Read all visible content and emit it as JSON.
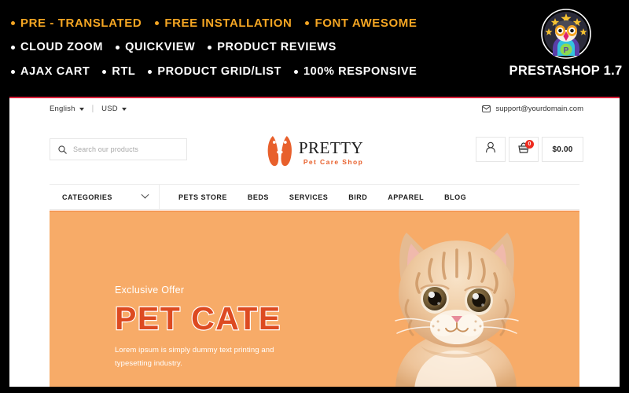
{
  "promo": {
    "rows": [
      {
        "style": "gold",
        "items": [
          {
            "label": "PRE - TRANSLATED",
            "bullet": "diamond-bullet-icon"
          },
          {
            "label": "FREE INSTALLATION",
            "bullet": "diamond-bullet-icon"
          },
          {
            "label": "FONT AWESOME",
            "bullet": "diamond-bullet-icon"
          }
        ]
      },
      {
        "style": "white",
        "items": [
          {
            "label": "CLOUD ZOOM",
            "bullet": "dot-bullet-icon"
          },
          {
            "label": "QUICKVIEW",
            "bullet": "dot-bullet-icon"
          },
          {
            "label": "PRODUCT REVIEWS",
            "bullet": "dot-bullet-icon"
          }
        ]
      },
      {
        "style": "white",
        "items": [
          {
            "label": "AJAX CART",
            "bullet": "dot-bullet-icon"
          },
          {
            "label": "RTL",
            "bullet": "dot-bullet-icon"
          },
          {
            "label": "PRODUCT GRID/LIST",
            "bullet": "dot-bullet-icon"
          },
          {
            "label": "100% RESPONSIVE",
            "bullet": "dot-bullet-icon"
          }
        ]
      }
    ],
    "prestashop": {
      "name": "PRESTASHOP 1.7",
      "logo_icon": "prestashop-owl-logo-icon"
    },
    "colors": {
      "background": "#000000",
      "gold": "#f5a623",
      "white": "#ffffff"
    }
  },
  "store": {
    "top_rule_color": "#d8203a",
    "utility": {
      "language": "English",
      "currency": "USD",
      "separator": "|",
      "support_email": "support@yourdomain.com",
      "mail_icon": "envelope-icon"
    },
    "search": {
      "placeholder": "Search our products",
      "value": "",
      "icon": "search-icon"
    },
    "brand": {
      "title": "PRETTY",
      "tagline": "Pet Care Shop",
      "mark_icon": "two-dogs-logo-icon",
      "accent": "#e8602c"
    },
    "actions": {
      "account_icon": "user-account-icon",
      "cart_icon": "shopping-cart-icon",
      "cart_count": "0",
      "cart_total": "$0.00",
      "badge_color": "#ee2b1f"
    },
    "nav": {
      "categories_label": "CATEGORIES",
      "categories_icon": "chevron-down-icon",
      "links": [
        "PETS STORE",
        "BEDS",
        "SERVICES",
        "BIRD",
        "APPAREL",
        "BLOG"
      ],
      "accent_color": "#f2803c"
    },
    "hero": {
      "eyebrow": "Exclusive Offer",
      "title": "PET CATE",
      "subtitle": "Lorem ipsum is simply dummy text printing and typesetting industry.",
      "background": "#f7ab68",
      "title_color": "#dd4a21",
      "image_icon": "kitten-photo"
    }
  }
}
